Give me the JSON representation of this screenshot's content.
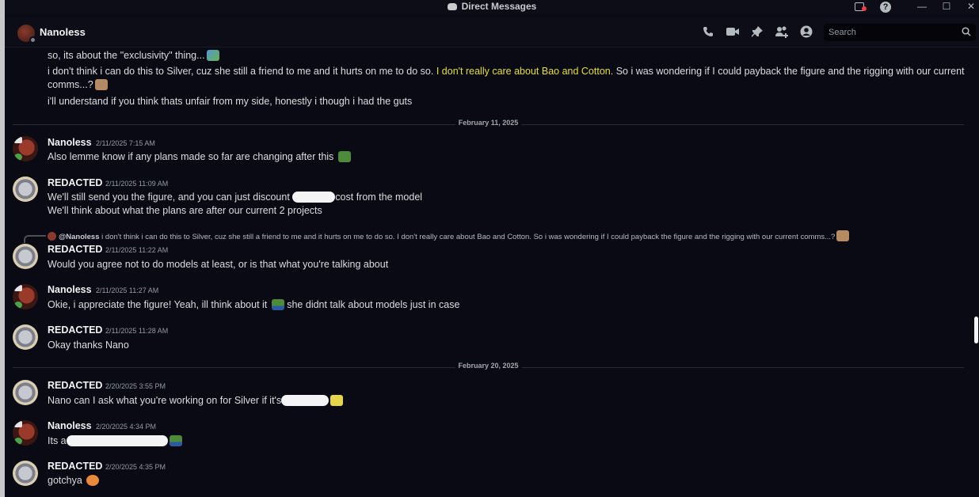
{
  "window": {
    "title": "Direct Messages"
  },
  "header": {
    "name": "Nanoless",
    "search_placeholder": "Search"
  },
  "continued_messages": [
    {
      "text": "so, its about the \"exclusivity\" thing..."
    },
    {
      "before": "i don't think i can do this to Silver, cuz she still a friend to me and it hurts on me to do so. ",
      "highlight": "I don't really care about Bao and Cotton.",
      "after": " So i was wondering if I could payback the figure and the rigging with our current"
    },
    {
      "text": "comms...?"
    },
    {
      "text": "i'll understand if you think thats unfair from my side, honestly i though i had the guts"
    }
  ],
  "dividers": [
    {
      "label": "February 11, 2025"
    },
    {
      "label": "February 20, 2025"
    }
  ],
  "messages": [
    {
      "author": "Nanoless",
      "timestamp": "2/11/2025 7:15 AM",
      "lines": [
        "Also lemme know if any plans made so far are changing after this"
      ]
    },
    {
      "author": "REDACTED",
      "timestamp": "2/11/2025 11:09 AM",
      "lines": [
        "We'll still send you the figure, and you can just discount",
        "cost from the model",
        "We'll think about what the plans are after our current 2 projects"
      ]
    },
    {
      "author": "REDACTED",
      "timestamp": "2/11/2025 11:22 AM",
      "reply_name": "@Nanoless",
      "reply_text": "i don't think i can do this to Silver, cuz she still a friend to me and it hurts on me to do so. I don't really care about Bao and Cotton. So i was wondering if I could payback the figure and the rigging with our current comms...?",
      "lines": [
        "Would you agree not to do models at least, or is that what you're talking about"
      ]
    },
    {
      "author": "Nanoless",
      "timestamp": "2/11/2025 11:27 AM",
      "lines": [
        "Okie, i appreciate the figure! Yeah, ill think about it",
        "she didnt talk about models just in case"
      ]
    },
    {
      "author": "REDACTED",
      "timestamp": "2/11/2025 11:28 AM",
      "lines": [
        "Okay thanks Nano"
      ]
    },
    {
      "author": "REDACTED",
      "timestamp": "2/20/2025 3:55 PM",
      "lines": [
        "Nano can I ask what you're working on for Silver if it's"
      ]
    },
    {
      "author": "Nanoless",
      "timestamp": "2/20/2025 4:34 PM",
      "lines": [
        "Its a"
      ]
    },
    {
      "author": "REDACTED",
      "timestamp": "2/20/2025 4:35 PM",
      "lines": [
        "gotchya"
      ]
    }
  ]
}
